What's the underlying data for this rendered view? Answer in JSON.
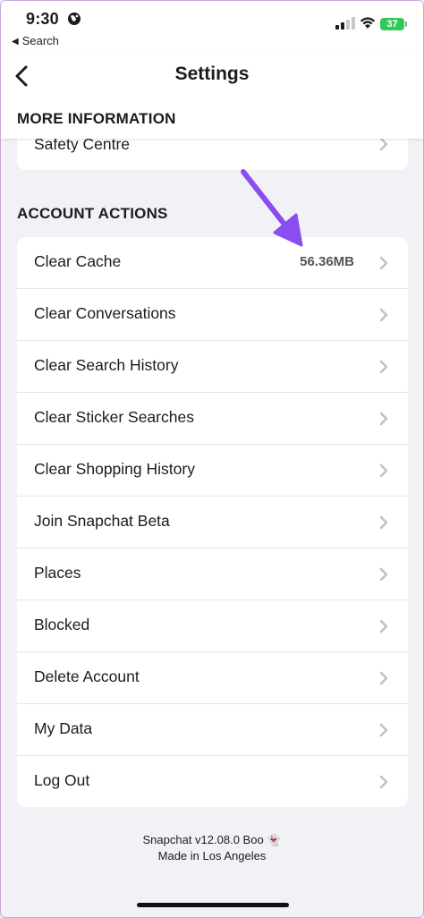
{
  "status_bar": {
    "time": "9:30",
    "back_app_label": "Search",
    "battery_level": "37"
  },
  "header": {
    "title": "Settings",
    "more_info_heading": "MORE INFORMATION"
  },
  "more_information": {
    "items": [
      {
        "label": "Safety Centre"
      }
    ]
  },
  "account_actions": {
    "heading": "ACCOUNT ACTIONS",
    "items": [
      {
        "label": "Clear Cache",
        "value": "56.36MB"
      },
      {
        "label": "Clear Conversations"
      },
      {
        "label": "Clear Search History"
      },
      {
        "label": "Clear Sticker Searches"
      },
      {
        "label": "Clear Shopping History"
      },
      {
        "label": "Join Snapchat Beta"
      },
      {
        "label": "Places"
      },
      {
        "label": "Blocked"
      },
      {
        "label": "Delete Account"
      },
      {
        "label": "My Data"
      },
      {
        "label": "Log Out"
      }
    ]
  },
  "footer": {
    "version": "Snapchat v12.08.0 Boo 👻",
    "made_in": "Made in Los Angeles"
  },
  "colors": {
    "annotation_arrow": "#8a4df0",
    "battery": "#34c759",
    "background": "#f2f2f6"
  }
}
